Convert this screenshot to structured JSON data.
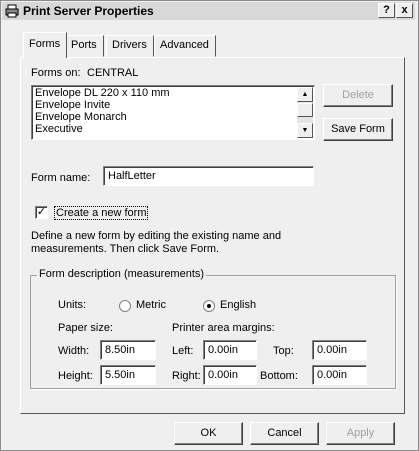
{
  "window": {
    "title": "Print Server Properties",
    "help_label": "?",
    "close_label": "x"
  },
  "tabs": [
    {
      "label": "Forms",
      "active": true
    },
    {
      "label": "Ports"
    },
    {
      "label": "Drivers"
    },
    {
      "label": "Advanced"
    }
  ],
  "forms": {
    "forms_on_label": "Forms on:",
    "server_name": "CENTRAL",
    "list_items": [
      "Envelope DL 220 x 110 mm",
      "Envelope Invite",
      "Envelope Monarch",
      "Executive"
    ],
    "delete_label": "Delete",
    "save_form_label": "Save Form",
    "form_name_label": "Form name:",
    "form_name_value": "HalfLetter",
    "create_new_label": "Create a new form",
    "create_new_checked": true,
    "description_line1": "Define a new form by editing the existing name and",
    "description_line2": "measurements.  Then click Save Form."
  },
  "measurements": {
    "legend": "Form description (measurements)",
    "units_label": "Units:",
    "metric_label": "Metric",
    "english_label": "English",
    "selected_unit": "English",
    "paper_size_label": "Paper size:",
    "printer_margins_label": "Printer area margins:",
    "width_label": "Width:",
    "width_value": "8.50in",
    "height_label": "Height:",
    "height_value": "5.50in",
    "left_label": "Left:",
    "left_value": "0.00in",
    "right_label": "Right:",
    "right_value": "0.00in",
    "top_label": "Top:",
    "top_value": "0.00in",
    "bottom_label": "Bottom:",
    "bottom_value": "0.00in"
  },
  "buttons": {
    "ok": "OK",
    "cancel": "Cancel",
    "apply": "Apply"
  }
}
